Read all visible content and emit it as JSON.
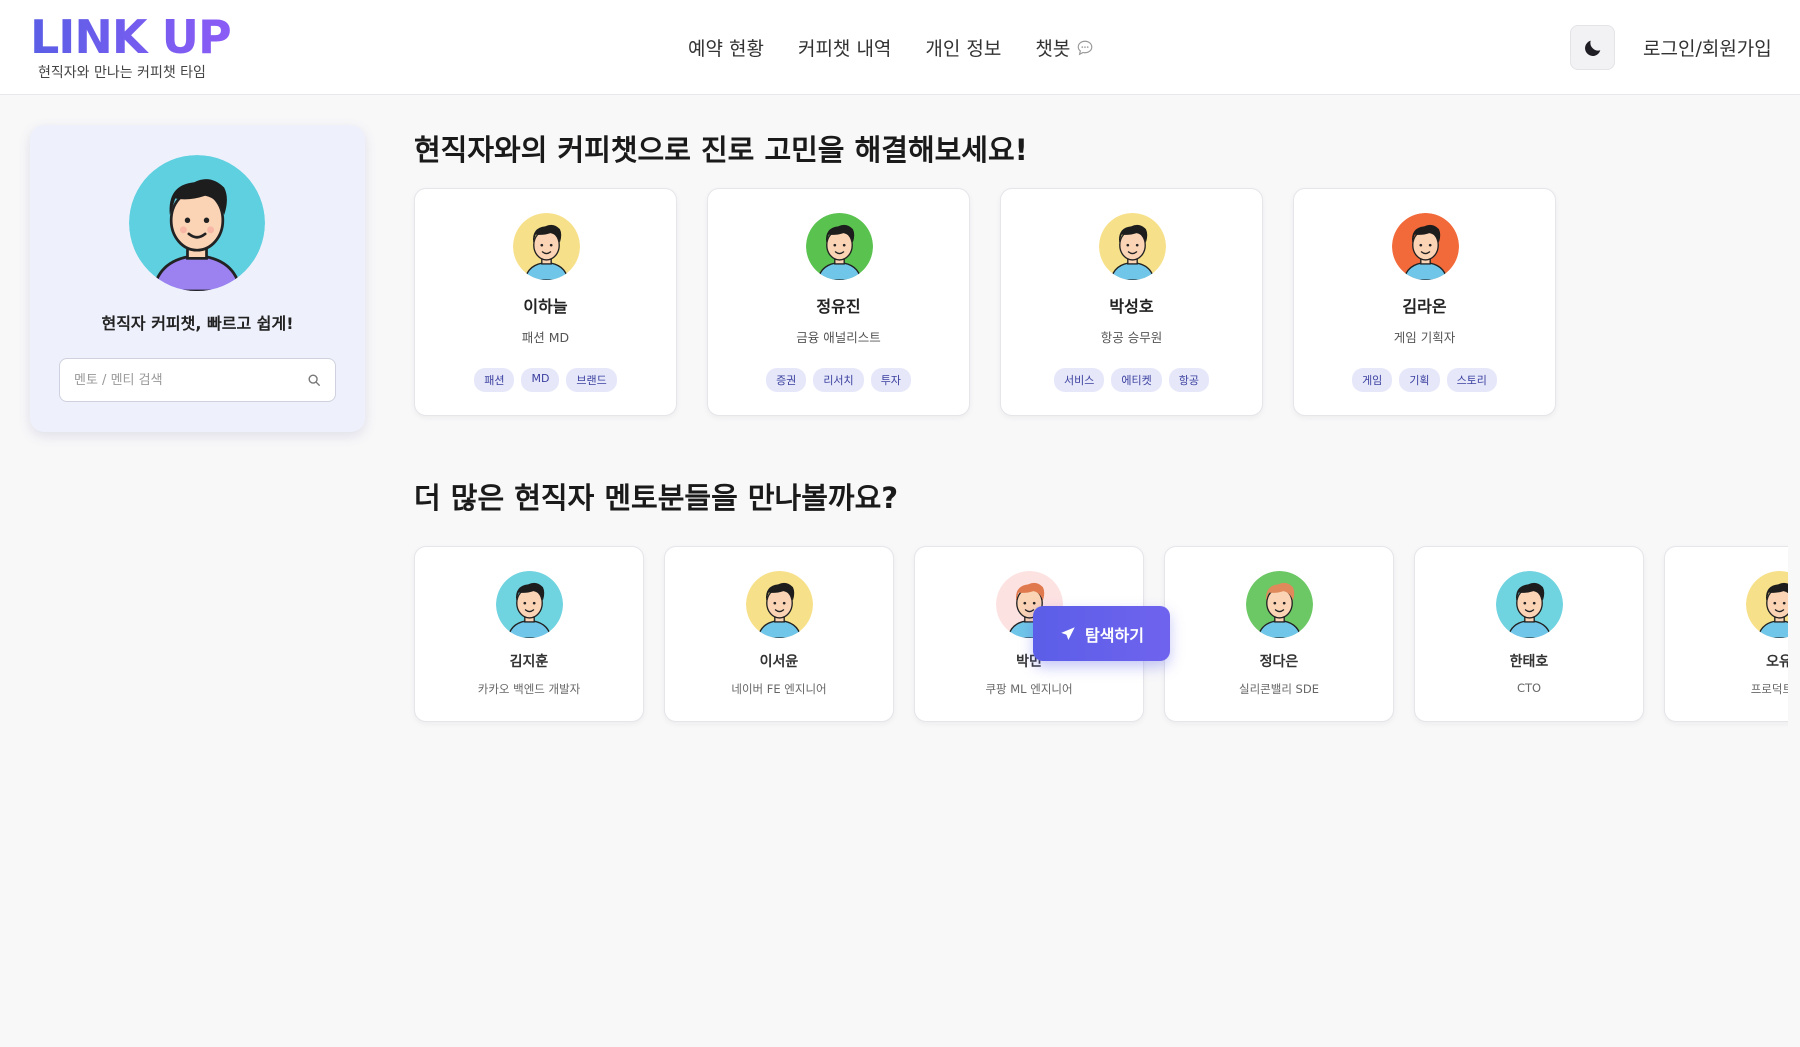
{
  "header": {
    "logo": "LINK UP",
    "logo_sub": "현직자와 만나는 커피챗 타임",
    "nav": [
      "예약 현황",
      "커피챗 내역",
      "개인 정보",
      "챗봇"
    ],
    "login": "로그인/회원가입"
  },
  "sidebar": {
    "title": "현직자 커피챗, 빠르고 쉽게!",
    "search_placeholder": "멘토 / 멘티 검색"
  },
  "featured": {
    "heading": "현직자와의 커피챗으로 진로 고민을 해결해보세요!",
    "cards": [
      {
        "name": "이하늘",
        "role": "패션 MD",
        "tags": [
          "패션",
          "MD",
          "브랜드"
        ],
        "bg": "#f7e08a"
      },
      {
        "name": "정유진",
        "role": "금융 애널리스트",
        "tags": [
          "증권",
          "리서치",
          "투자"
        ],
        "bg": "#5ac24f"
      },
      {
        "name": "박성호",
        "role": "항공 승무원",
        "tags": [
          "서비스",
          "에티켓",
          "항공"
        ],
        "bg": "#f7e08a"
      },
      {
        "name": "김라온",
        "role": "게임 기획자",
        "tags": [
          "게임",
          "기획",
          "스토리"
        ],
        "bg": "#f26a3a"
      }
    ]
  },
  "mentors": {
    "heading": "더 많은 현직자 멘토분들을 만나볼까요?",
    "cards": [
      {
        "name": "김지훈",
        "role": "카카오 백엔드 개발자",
        "bg": "#6fd3e0"
      },
      {
        "name": "이서윤",
        "role": "네이버 FE 엔지니어",
        "bg": "#f7e08a"
      },
      {
        "name": "박민",
        "role": "쿠팡 ML 엔지니어",
        "bg": "#fde2e2"
      },
      {
        "name": "정다은",
        "role": "실리콘밸리 SDE",
        "bg": "#6cc865"
      },
      {
        "name": "한태호",
        "role": "CTO",
        "bg": "#6fd3e0"
      },
      {
        "name": "오유",
        "role": "프로덕트 디",
        "bg": "#f7e08a"
      }
    ]
  },
  "explore_button": "탐색하기",
  "colors": {
    "accent": "#5b5ee8",
    "tag_bg": "#e6e8fa",
    "tag_text": "#3b3f9e",
    "sidebar_bg": "#eef0fb"
  }
}
